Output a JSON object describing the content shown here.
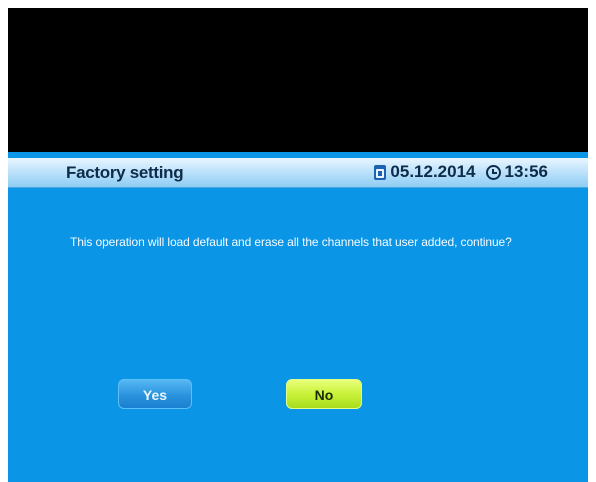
{
  "header": {
    "title": "Factory setting",
    "date": "05.12.2014",
    "time": "13:56",
    "date_icon": "calendar-icon",
    "time_icon": "clock-icon"
  },
  "dialog": {
    "message": "This operation will load default and erase all the channels that user added, continue?",
    "buttons": {
      "yes_label": "Yes",
      "no_label": "No",
      "selected": "No"
    }
  },
  "colors": {
    "background": "#0a95e6",
    "title_bar": "#bfe3fb",
    "selected_button": "#c9f23a",
    "unselected_button": "#2a93de"
  }
}
